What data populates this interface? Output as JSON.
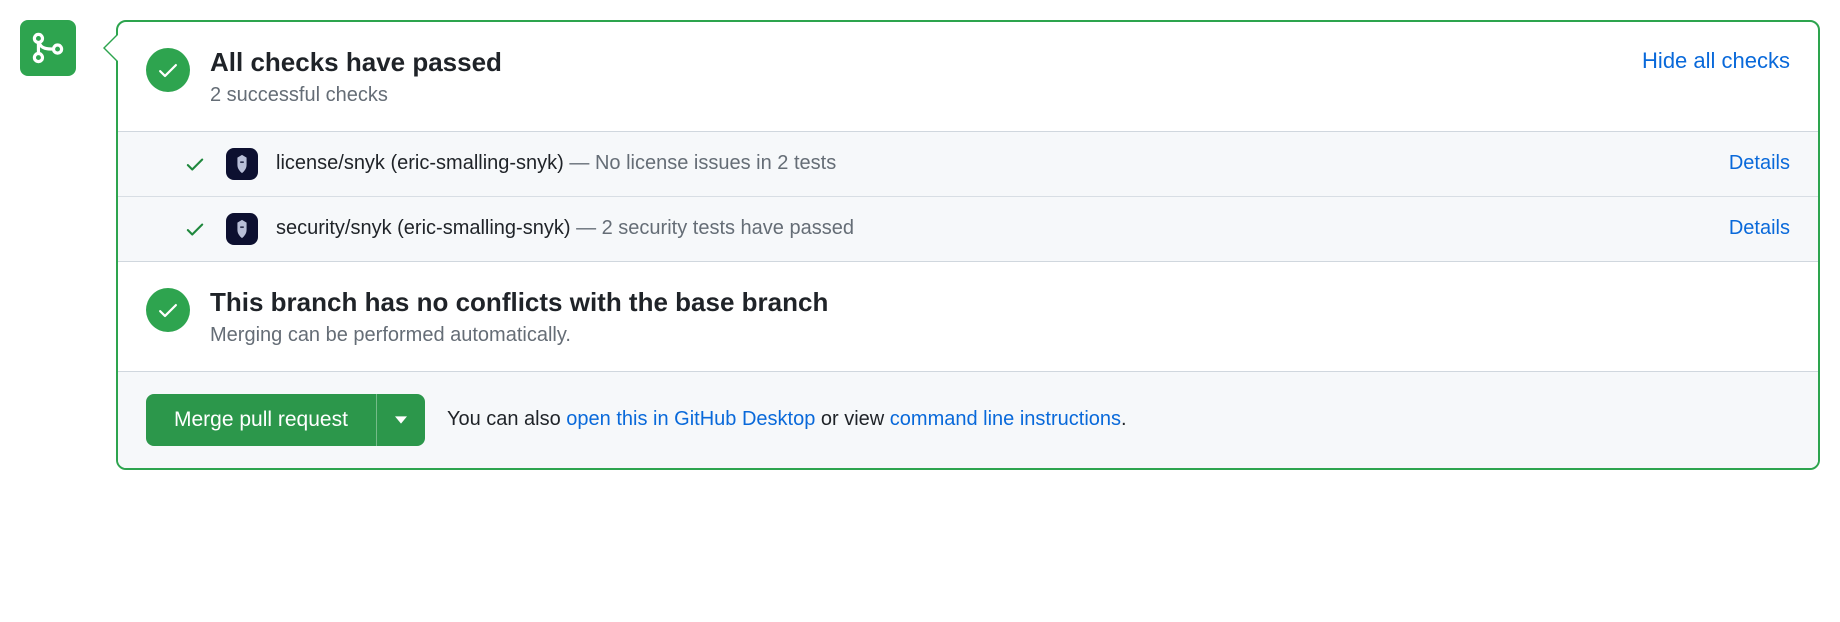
{
  "header": {
    "title": "All checks have passed",
    "subtitle": "2 successful checks",
    "toggle_label": "Hide all checks"
  },
  "checks": [
    {
      "name": "license/snyk (eric-smalling-snyk)",
      "description": "No license issues in 2 tests",
      "details_label": "Details"
    },
    {
      "name": "security/snyk (eric-smalling-snyk)",
      "description": "2 security tests have passed",
      "details_label": "Details"
    }
  ],
  "conflict": {
    "title": "This branch has no conflicts with the base branch",
    "subtitle": "Merging can be performed automatically."
  },
  "merge": {
    "button_label": "Merge pull request",
    "helper_prefix": "You can also ",
    "desktop_link": "open this in GitHub Desktop",
    "helper_middle": " or view ",
    "cli_link": "command line instructions",
    "helper_suffix": "."
  }
}
